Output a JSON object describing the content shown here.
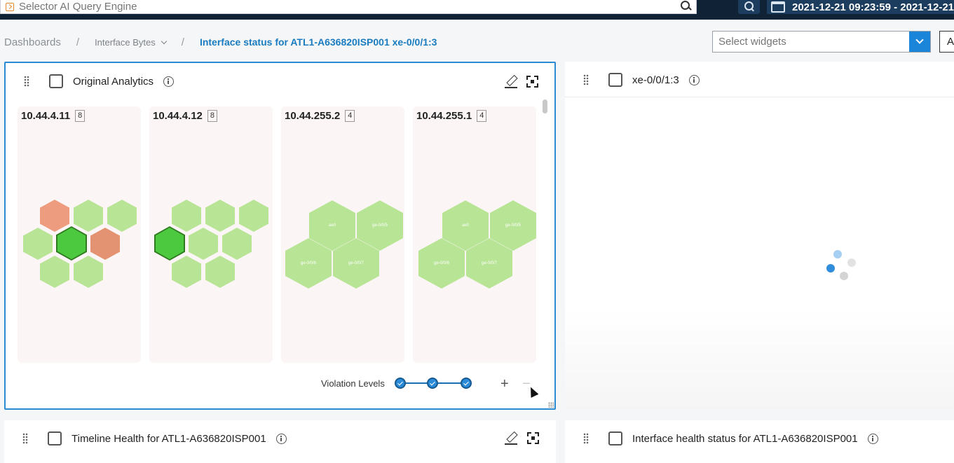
{
  "topbar": {
    "search_placeholder": "Selector AI Query Engine",
    "date_range": "2021-12-21 09:23:59 - 2021-12-21"
  },
  "breadcrumb": {
    "dashboards": "Dashboards",
    "sep": "/",
    "interface_bytes": "Interface Bytes",
    "current": "Interface status for ATL1-A636820ISP001 xe-0/0/1:3"
  },
  "select_widgets": {
    "placeholder": "Select widgets",
    "extra_button": "A"
  },
  "widgets": {
    "original_analytics": {
      "title": "Original Analytics",
      "devices": [
        {
          "ip": "10.44.4.11",
          "count": "8"
        },
        {
          "ip": "10.44.4.12",
          "count": "8"
        },
        {
          "ip": "10.44.255.2",
          "count": "4"
        },
        {
          "ip": "10.44.255.1",
          "count": "4"
        }
      ],
      "hex_labels_large": [
        "ae0",
        "ge-0/0/5",
        "ge-0/0/6",
        "ge-0/0/7"
      ],
      "violation_label": "Violation Levels",
      "plus": "+",
      "minus": "−"
    },
    "xe_widget": {
      "title": "xe-0/0/1:3"
    },
    "timeline": {
      "title": "Timeline Health for ATL1-A636820ISP001"
    },
    "interface_health": {
      "title": "Interface health status for ATL1-A636820ISP001"
    }
  },
  "colors": {
    "accent": "#1a7cc0",
    "healthy": "#b8e495",
    "selected": "#4cc93f",
    "warning": "#ee9c7f",
    "critical": "#e39272"
  }
}
